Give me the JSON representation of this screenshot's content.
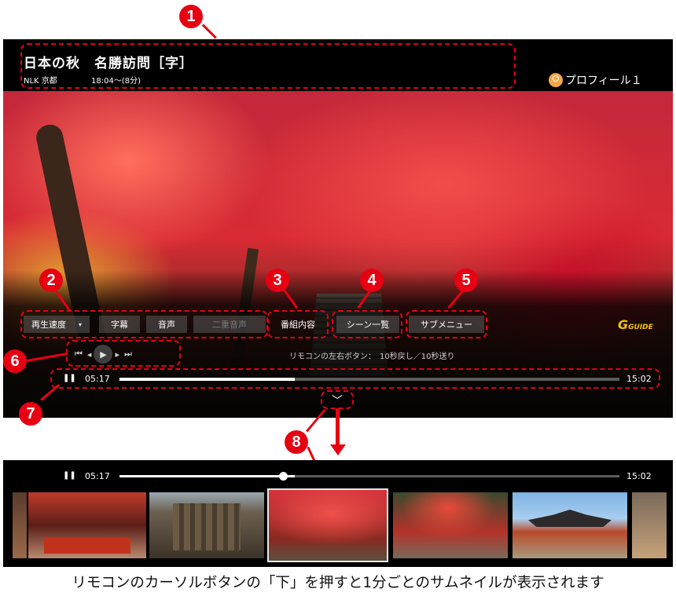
{
  "header": {
    "title": "日本の秋　名勝訪問［字］",
    "channel": "NLK 京都",
    "time": "18:04〜(8分)",
    "profile_label": "プロフィール１"
  },
  "controls": {
    "speed_label": "再生速度",
    "speed_arrow": "▾",
    "subtitle_label": "字幕",
    "audio_label": "音声",
    "dual_audio_label": "二重音声",
    "program_info_label": "番組内容",
    "scene_list_label": "シーン一覧",
    "submenu_label": "サブメニュー",
    "gguide_label": "GUIDE"
  },
  "transport": {
    "skip_back_label": "⏮",
    "step_back_label": "◂",
    "play_label": "▶",
    "step_fwd_label": "▸",
    "skip_fwd_label": "⏭",
    "hint": "リモコンの左右ボタン：　10秒戻し／10秒送り"
  },
  "progress": {
    "pause_label": "❚❚",
    "elapsed": "05:17",
    "total": "15:02",
    "fraction": 0.35
  },
  "thumbnail_strip": {
    "pause_label": "❚❚",
    "elapsed": "05:17",
    "total": "15:02",
    "fraction": 0.35,
    "thumbnails": [
      "red-veranda",
      "temple-gate",
      "red-maple-current",
      "autumn-path",
      "palace-hall",
      "stone-lantern"
    ]
  },
  "down_chevron": "﹀",
  "markers": [
    "1",
    "2",
    "3",
    "4",
    "5",
    "6",
    "7",
    "8"
  ],
  "caption": "リモコンのカーソルボタンの「下」を押すと1分ごとのサムネイルが表示されます",
  "colors": {
    "marker_red": "#e60012",
    "gguide_yellow": "#f5c400",
    "profile_orange": "#f4a64a"
  }
}
